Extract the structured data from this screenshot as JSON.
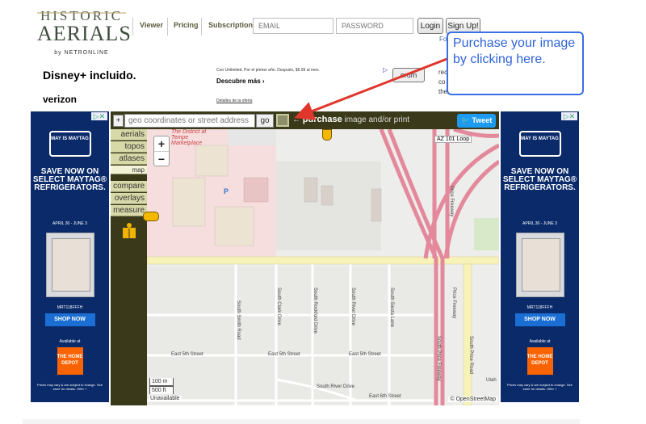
{
  "header": {
    "logo": {
      "line1": "HISTORIC",
      "line2": "AERIALS",
      "line3": "by NETRONLINE"
    },
    "nav": [
      "Viewer",
      "Pricing",
      "Subscription"
    ],
    "email_placeholder": "EMAIL",
    "password_placeholder": "PASSWORD",
    "login_label": "Login",
    "signup_label": "Sign Up!",
    "forgot_fragment": "Fo"
  },
  "top_ad": {
    "brand": "Disney+ incluido.",
    "carrier": "verizon",
    "promo_text": "Con Unlimited. Por el primer año. Después, $6.99 al mes.",
    "cta": "Descubre más ›",
    "fine_print": "Detalles de la oferta"
  },
  "forum_label": "orum",
  "side_fragments": [
    "rec",
    "co",
    "the"
  ],
  "callout_text": "Purchase your image by clicking here.",
  "side_ad": {
    "badge": "MAY IS MAYTAG",
    "headline": "SAVE NOW ON SELECT MAYTAG® REFRIGERATORS.",
    "dates": "APRIL 30 - JUNE 3",
    "model": "MRT118FFFH",
    "shop": "SHOP NOW",
    "avail": "Available at",
    "store": "THE HOME DEPOT",
    "fine": "Prices may vary & are subject to change. See store for details. Offer +"
  },
  "viewer": {
    "plus_label": "+",
    "search_placeholder": "geo coordinates or street address",
    "go_label": "go",
    "purchase_arrow": "←",
    "purchase_bold": "purchase",
    "purchase_text": "image and/or print",
    "tweet_label": "Tweet",
    "tabs": [
      "aerials",
      "topos",
      "atlases",
      "map",
      "compare",
      "overlays",
      "measure"
    ],
    "zoom_in": "+",
    "zoom_out": "−",
    "scale_m": "100 m",
    "scale_ft": "500 ft",
    "unavailable": "Unavailable",
    "attribution": "© OpenStreetMap",
    "hwy_label": "AZ 101 Loop",
    "marketplace": "The District at Tempe Marketplace",
    "streets": {
      "e5_a": "East 5th Street",
      "e5_b": "East 5th Street",
      "e5_c": "East 5th Street",
      "e6": "East 6th Street",
      "river_dr": "South River Drive",
      "smith": "South Smith Road",
      "clark": "South Clark Drive",
      "rockford": "South Rockford Drive",
      "river": "South River Drive",
      "siesta": "South Siesta Lane",
      "price_rd": "South Price Road",
      "price_fwy": "Price Freeway",
      "price_fwy2": "Price Freeway",
      "price_fwy3": "South Price Freeway",
      "utah": "Utah"
    },
    "parking": "P"
  }
}
